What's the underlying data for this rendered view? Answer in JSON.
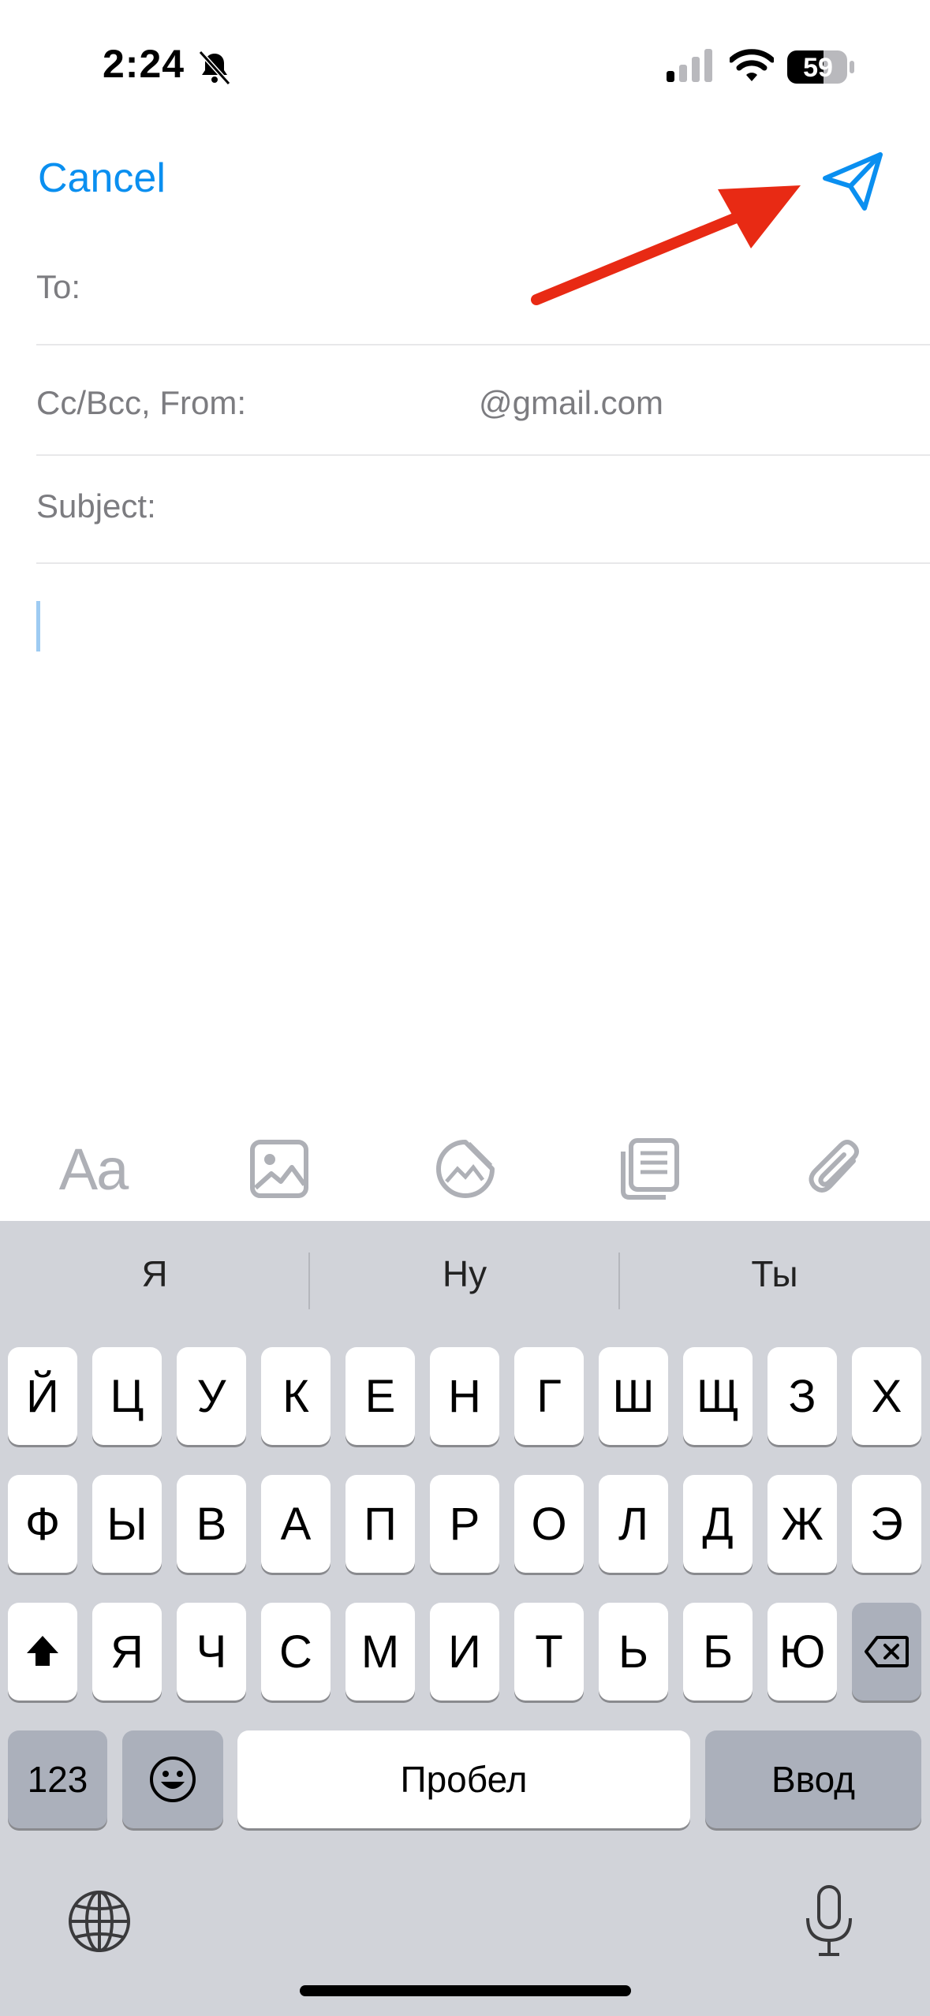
{
  "status_bar": {
    "time": "2:24",
    "battery": "59",
    "icons": [
      "bell-slash-icon",
      "cellular-signal-icon",
      "wifi-icon",
      "battery-icon"
    ]
  },
  "header": {
    "cancel_label": "Cancel",
    "send_icon": "paper-plane-icon",
    "annotation_icon": "red-arrow-icon"
  },
  "fields": {
    "to_label": "To:",
    "cc_from_label": "Cc/Bcc, From:",
    "from_email": "@gmail.com",
    "subject_label": "Subject:"
  },
  "toolbar": {
    "format_label": "Aa",
    "icons": [
      "text-format-icon",
      "photo-icon",
      "sticker-icon",
      "scan-document-icon",
      "attachment-icon"
    ]
  },
  "keyboard": {
    "suggestions": [
      "Я",
      "Ну",
      "Ты"
    ],
    "row1": [
      "Й",
      "Ц",
      "У",
      "К",
      "Е",
      "Н",
      "Г",
      "Ш",
      "Щ",
      "З",
      "Х"
    ],
    "row2": [
      "Ф",
      "Ы",
      "В",
      "А",
      "П",
      "Р",
      "О",
      "Л",
      "Д",
      "Ж",
      "Э"
    ],
    "row3": [
      "Я",
      "Ч",
      "С",
      "М",
      "И",
      "Т",
      "Ь",
      "Б",
      "Ю"
    ],
    "numbers_label": "123",
    "space_label": "Пробел",
    "return_label": "Ввод",
    "icons": [
      "shift-icon",
      "backspace-icon",
      "emoji-icon",
      "globe-icon",
      "microphone-icon"
    ]
  },
  "colors": {
    "accent": "#0a8ff0",
    "annotation": "#e82a14",
    "keyboard_bg": "#d1d3d9"
  }
}
